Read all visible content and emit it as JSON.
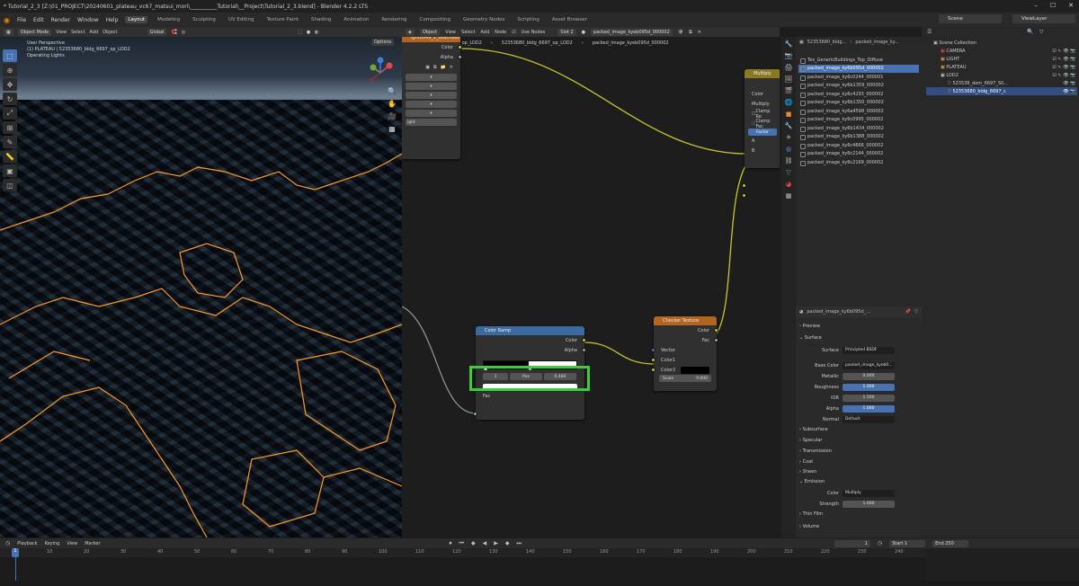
{
  "window": {
    "title": "* Tutorial_2_3 [Z:\\01_PROJECT\\20240601_plateau_vc67_matsui_mori\\__________Tutorial\\__Project\\Tutorial_2_3.blend] - Blender 4.2.2 LTS"
  },
  "menubar": {
    "items": [
      "File",
      "Edit",
      "Render",
      "Window",
      "Help"
    ],
    "workspaces": [
      "Layout",
      "Modeling",
      "Sculpting",
      "UV Editing",
      "Texture Paint",
      "Shading",
      "Animation",
      "Rendering",
      "Compositing",
      "Geometry Nodes",
      "Scripting",
      "Asset Browser"
    ],
    "active_workspace": "Layout",
    "scene": "Scene",
    "view_layer": "ViewLayer"
  },
  "viewport": {
    "mode": "Object Mode",
    "menus": [
      "View",
      "Select",
      "Add",
      "Object"
    ],
    "transform": "Global",
    "options": "Options",
    "info": [
      "User Perspective",
      "(1) PLATEAU | 52353680_bldg_6697_op_LOD2",
      "Operating Lights"
    ],
    "tools": [
      "select",
      "cursor",
      "move",
      "rotate",
      "scale",
      "transform",
      "annotate",
      "measure",
      "add-cube",
      "camera"
    ]
  },
  "node_editor": {
    "mode": "Object",
    "menus": [
      "View",
      "Select",
      "Add",
      "Node"
    ],
    "use_nodes": "Use Nodes",
    "slot": "Slot 2",
    "image_name": "packed_image_kyeb095d_000002",
    "breadcrumbs": [
      "52353680_bldg_6697_op_LOD2",
      "52353680_bldg_6697_op_LOD2",
      "packed_image_kyeb095d_000002"
    ],
    "partial_node_title": "ight0049_1_seamless",
    "partial_node_outputs": [
      "Color",
      "Alpha"
    ],
    "partial_node_last": "ight",
    "multiply": {
      "title": "Multiply",
      "rows": [
        "Color",
        "Multiply",
        "Clamp Re",
        "Clamp Fac",
        "Factor",
        "A",
        "B"
      ]
    },
    "color_ramp": {
      "title": "Color Ramp",
      "outputs": [
        "Color",
        "Alpha"
      ],
      "pos_index": "1",
      "pos_label": "Pos",
      "pos_value": "0.486",
      "input": "Fac"
    },
    "checker": {
      "title": "Checker Texture",
      "outputs": [
        "Color",
        "Fac"
      ],
      "inputs": [
        "Vector",
        "Color1",
        "Color2"
      ],
      "scale_label": "Scale",
      "scale_value": "9.000"
    }
  },
  "image_browser": {
    "header": "52353680_bldg...",
    "header2": "packed_image_ky...",
    "items": [
      "Tex_GenericBuildings_Top_Diffuse",
      "packed_image_ky6b095d_000002",
      "packed_image_ky6c0244_000001",
      "packed_image_ky6b1359_000002",
      "packed_image_ky6c4293_000002",
      "packed_image_ky6b1350_000002",
      "packed_image_ky6a4598_000002",
      "packed_image_ky6c0995_000002",
      "packed_image_ky6b1434_000002",
      "packed_image_ky6b1388_000002",
      "packed_image_ky6c4666_000002",
      "packed_image_ky6c2144_000002",
      "packed_image_ky6c2169_000002"
    ],
    "selected_index": 1
  },
  "material": {
    "header": "packed_image_ky6b095d_...",
    "sections": [
      "Preview",
      "Surface",
      "Subsurface",
      "Specular",
      "Transmission",
      "Coat",
      "Sheen",
      "Emission",
      "Thin Film",
      "Volume"
    ],
    "surface_label": "Surface",
    "surface_value": "Principled BSDF",
    "base_color_label": "Base Color",
    "base_color_value": "packed_image_kyeb0...",
    "metallic_label": "Metallic",
    "metallic_value": "0.000",
    "roughness_label": "Roughness",
    "roughness_value": "1.000",
    "ior_label": "IOR",
    "ior_value": "1.500",
    "alpha_label": "Alpha",
    "alpha_value": "1.000",
    "normal_label": "Normal",
    "normal_value": "Default",
    "emission_color_label": "Color",
    "emission_color_value": "Multiply",
    "strength_label": "Strength",
    "strength_value": "1.000"
  },
  "outliner": {
    "root": "Scene Collection",
    "items": [
      {
        "label": "CAMERA",
        "depth": 1
      },
      {
        "label": "LIGHT",
        "depth": 1
      },
      {
        "label": "PLATEAU",
        "depth": 1
      },
      {
        "label": "LOD2",
        "depth": 1
      },
      {
        "label": "523536_dem_6697_S0...",
        "depth": 2
      },
      {
        "label": "52353680_bldg_6697_c",
        "depth": 2,
        "selected": true
      }
    ]
  },
  "timeline": {
    "menus": [
      "Playback",
      "Keying",
      "View",
      "Marker"
    ],
    "current_frame": "1",
    "start_label": "Start",
    "start_value": "1",
    "end_label": "End",
    "end_value": "250",
    "ticks": [
      "1",
      "10",
      "20",
      "30",
      "40",
      "50",
      "60",
      "70",
      "80",
      "90",
      "100",
      "110",
      "120",
      "130",
      "140",
      "150",
      "160",
      "170",
      "180",
      "190",
      "200",
      "210",
      "220",
      "230",
      "240"
    ]
  },
  "colors": {
    "selection_outline": "#ff9a2a",
    "highlight_box": "#3fcb3f",
    "accent": "#4772b3",
    "link_yellow": "#c7c729",
    "color_ramp_header": "#3a6aa0",
    "checker_header": "#b3641f",
    "multiply_header": "#8a7a1f"
  }
}
